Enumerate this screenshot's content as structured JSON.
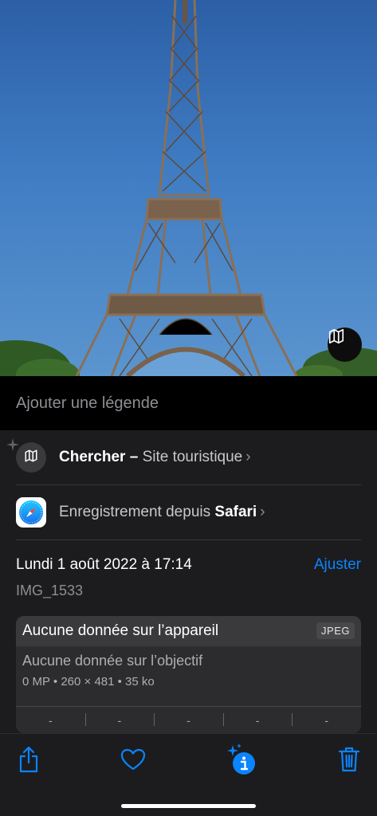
{
  "photo": {
    "subject_icon": "eiffel-tower-photo",
    "map_button_icon": "map-icon"
  },
  "caption": {
    "placeholder": "Ajouter une légende"
  },
  "lookup": {
    "icon": "map-icon",
    "label_bold": "Chercher –",
    "label_rest": "Site touristique",
    "chevron": "›"
  },
  "source": {
    "icon": "safari-icon",
    "label_prefix": "Enregistrement depuis ",
    "label_bold": "Safari",
    "chevron": "›"
  },
  "metadata": {
    "date": "Lundi 1 août 2022 à 17:14",
    "adjust_label": "Ajuster",
    "filename": "IMG_1533"
  },
  "device_card": {
    "title": "Aucune donnée sur l’appareil",
    "format_badge": "JPEG",
    "lens": "Aucune donnée sur l’objectif",
    "specs": "0 MP  •  260 × 481  •  35 ko",
    "exif": [
      "-",
      "-",
      "-",
      "-",
      "-"
    ]
  },
  "toolbar": {
    "share_icon": "share-icon",
    "favorite_icon": "heart-icon",
    "info_icon": "info-sparkle-icon",
    "delete_icon": "trash-icon"
  },
  "colors": {
    "accent": "#0a84ff",
    "panel": "#1c1c1e",
    "background": "#000000"
  }
}
